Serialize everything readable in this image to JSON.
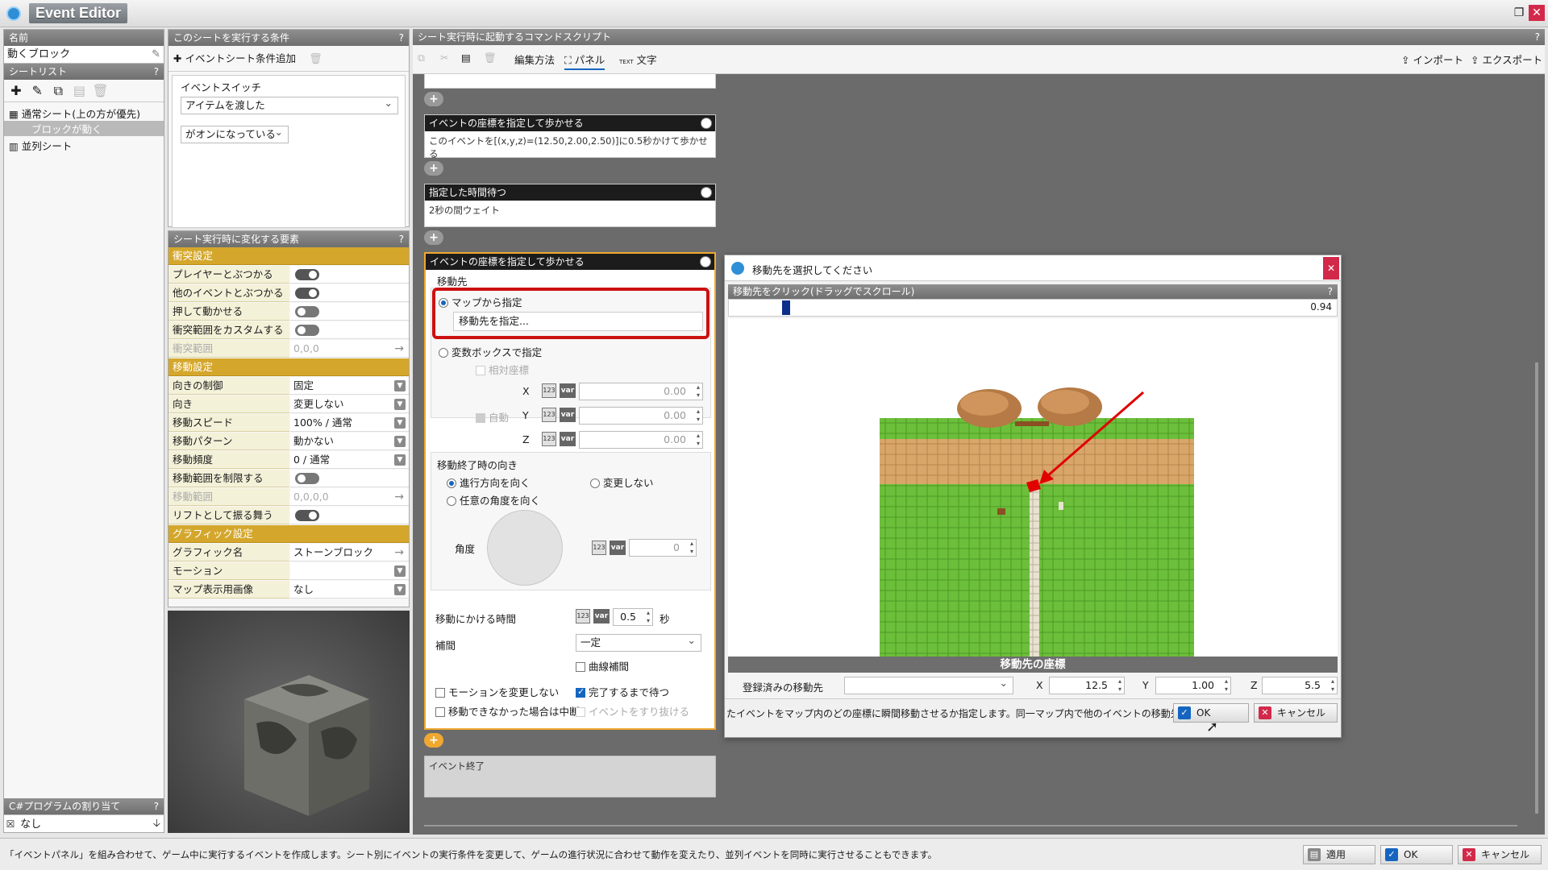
{
  "app": {
    "title": "Event Editor"
  },
  "left": {
    "name_header": "名前",
    "name_value": "動くブロック",
    "sheet_list_header": "シートリスト",
    "sheets": [
      {
        "label": "通常シート(上の方が優先)"
      },
      {
        "label": "ブロックが動く"
      },
      {
        "label": "並列シート"
      }
    ],
    "csharp_header": "C#プログラムの割り当て",
    "csharp_value": "なし"
  },
  "conditions": {
    "header": "このシートを実行する条件",
    "add_label": "イベントシート条件追加",
    "switch_label": "イベントスイッチ",
    "switch_value": "アイテムを渡した",
    "state_value": "がオンになっている"
  },
  "properties": {
    "header": "シート実行時に変化する要素",
    "rows": [
      {
        "label": "衝突設定",
        "type": "section"
      },
      {
        "label": "プレイヤーとぶつかる",
        "type": "toggle",
        "on": true
      },
      {
        "label": "他のイベントとぶつかる",
        "type": "toggle",
        "on": true
      },
      {
        "label": "押して動かせる",
        "type": "toggle",
        "on": false
      },
      {
        "label": "衝突範囲をカスタムする",
        "type": "toggle",
        "on": false
      },
      {
        "label": "衝突範囲",
        "type": "disabled",
        "value": "0,0,0"
      },
      {
        "label": "移動設定",
        "type": "section"
      },
      {
        "label": "向きの制御",
        "type": "dropdown",
        "value": "固定"
      },
      {
        "label": "向き",
        "type": "dropdown",
        "value": "変更しない"
      },
      {
        "label": "移動スピード",
        "type": "dropdown",
        "value": "100% / 通常"
      },
      {
        "label": "移動パターン",
        "type": "dropdown",
        "value": "動かない"
      },
      {
        "label": "移動頻度",
        "type": "dropdown",
        "value": "0 / 通常"
      },
      {
        "label": "移動範囲を制限する",
        "type": "toggle",
        "on": false
      },
      {
        "label": "移動範囲",
        "type": "disabled",
        "value": "0,0,0,0"
      },
      {
        "label": "リフトとして振る舞う",
        "type": "toggle",
        "on": true
      },
      {
        "label": "グラフィック設定",
        "type": "section"
      },
      {
        "label": "グラフィック名",
        "type": "arrow",
        "value": "ストーンブロック"
      },
      {
        "label": "モーション",
        "type": "dropdown",
        "value": ""
      },
      {
        "label": "マップ表示用画像",
        "type": "dropdown",
        "value": "なし"
      }
    ]
  },
  "script": {
    "header": "シート実行時に起動するコマンドスクリプト",
    "toolbar": {
      "edit_method": "編集方法",
      "panel": "パネル",
      "text": "文字",
      "text_icon": "TEXT",
      "import": "インポート",
      "export": "エクスポート"
    },
    "cmd1": {
      "title": "イベントの座標を指定して歩かせる",
      "body": "このイベントを[(x,y,z)=(12.50,2.00,2.50)]に0.5秒かけて歩かせる"
    },
    "cmd2": {
      "title": "指定した時間待つ",
      "body": "2秒の間ウェイト"
    },
    "cmd3": {
      "title": "イベントの座標を指定して歩かせる",
      "dest_label": "移動先",
      "from_map": "マップから指定",
      "choose_dest": "移動先を指定...",
      "from_var": "変数ボックスで指定",
      "relative": "相対座標",
      "auto": "自動",
      "x_label": "X",
      "y_label": "Y",
      "z_label": "Z",
      "x_val": "0.00",
      "y_val": "0.00",
      "z_val": "0.00",
      "num_icon": "123",
      "var_icon": "var",
      "end_dir_label": "移動終了時の向き",
      "dir_forward": "進行方向を向く",
      "dir_nochange": "変更しない",
      "dir_any": "任意の角度を向く",
      "angle_label": "角度",
      "angle_val": "0",
      "time_label": "移動にかける時間",
      "time_val": "0.5",
      "time_unit": "秒",
      "interp_label": "補間",
      "interp_val": "一定",
      "curve": "曲線補間",
      "nomotion": "モーションを変更しない",
      "waitdone": "完了するまで待つ",
      "abort": "移動できなかった場合は中断",
      "passthrough": "イベントをすり抜ける"
    },
    "end_label": "イベント終了"
  },
  "dialog": {
    "title": "移動先を選択してください",
    "hint": "移動先をクリック(ドラッグでスクロール)",
    "zoom": "0.94",
    "coords_title": "移動先の座標",
    "registered_label": "登録済みの移動先",
    "x_label": "X",
    "x_val": "12.5",
    "y_label": "Y",
    "y_val": "1.00",
    "z_label": "Z",
    "z_val": "5.5",
    "desc": "たイベントをマップ内のどの座標に瞬間移動させるか指定します。同一マップ内で他のイベントの移動先が指定",
    "ok": "OK",
    "cancel": "キャンセル"
  },
  "status": {
    "text": "「イベントパネル」を組み合わせて、ゲーム中に実行するイベントを作成します。シート別にイベントの実行条件を変更して、ゲームの進行状況に合わせて動作を変えたり、並列イベントを同時に実行させることもできます。",
    "apply": "適用",
    "ok": "OK",
    "cancel": "キャンセル"
  },
  "colors": {
    "accent": "#d4a72c",
    "highlight": "#cc1111",
    "dark_header": "#1c1c1c",
    "grass": "#6cbf3a"
  }
}
